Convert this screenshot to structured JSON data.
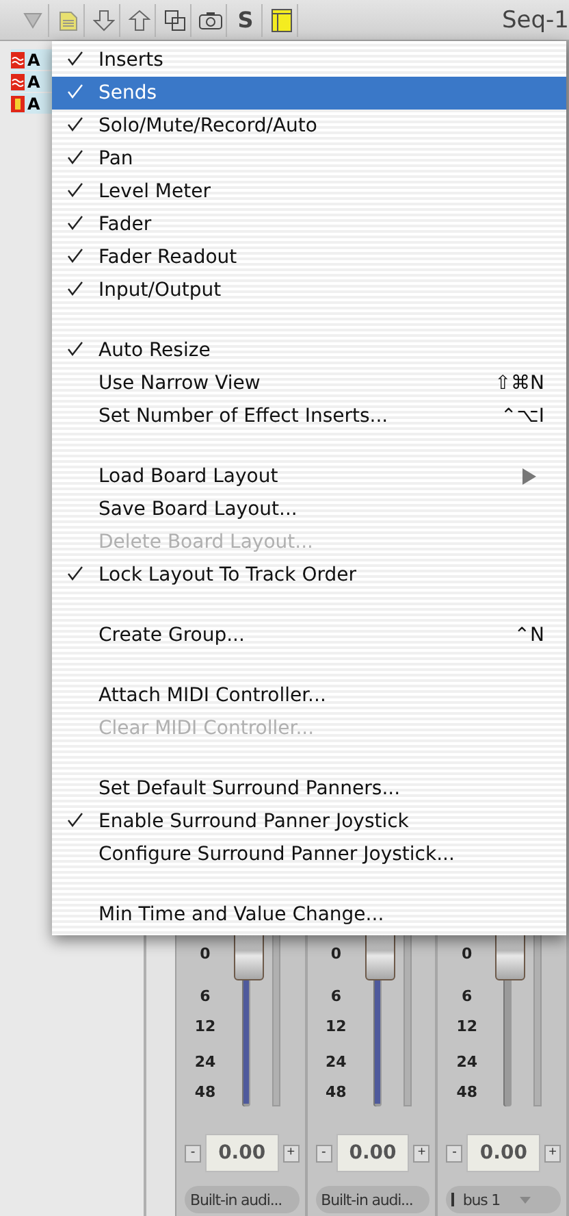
{
  "toolbar": {
    "buttons": [
      {
        "kind": "filter"
      },
      {
        "kind": "folder"
      },
      {
        "kind": "down"
      },
      {
        "kind": "up"
      },
      {
        "kind": "squares"
      },
      {
        "kind": "camera"
      },
      {
        "kind": "text",
        "label": "S"
      },
      {
        "kind": "window"
      }
    ],
    "title": "Seq-1"
  },
  "track_list": [
    {
      "label": "A",
      "kind": "audio"
    },
    {
      "label": "A",
      "kind": "audio"
    },
    {
      "label": "A",
      "kind": "instrument"
    }
  ],
  "menu": [
    {
      "kind": "item",
      "label": "Inserts",
      "checked": true,
      "selected": false,
      "disabled": false
    },
    {
      "kind": "item",
      "label": "Sends",
      "checked": true,
      "selected": true,
      "disabled": false
    },
    {
      "kind": "item",
      "label": "Solo/Mute/Record/Auto",
      "checked": true,
      "selected": false,
      "disabled": false
    },
    {
      "kind": "item",
      "label": "Pan",
      "checked": true,
      "selected": false,
      "disabled": false
    },
    {
      "kind": "item",
      "label": "Level Meter",
      "checked": true,
      "selected": false,
      "disabled": false
    },
    {
      "kind": "item",
      "label": "Fader",
      "checked": true,
      "selected": false,
      "disabled": false
    },
    {
      "kind": "item",
      "label": "Fader Readout",
      "checked": true,
      "selected": false,
      "disabled": false
    },
    {
      "kind": "item",
      "label": "Input/Output",
      "checked": true,
      "selected": false,
      "disabled": false
    },
    {
      "kind": "separator"
    },
    {
      "kind": "item",
      "label": "Auto Resize",
      "checked": true,
      "selected": false,
      "disabled": false
    },
    {
      "kind": "item",
      "label": "Use Narrow View",
      "checked": false,
      "selected": false,
      "disabled": false,
      "shortcut": "⇧⌘N"
    },
    {
      "kind": "item",
      "label": "Set Number of Effect Inserts...",
      "checked": false,
      "selected": false,
      "disabled": false,
      "shortcut": "⌃⌥I"
    },
    {
      "kind": "separator"
    },
    {
      "kind": "item",
      "label": "Load Board Layout",
      "checked": false,
      "selected": false,
      "disabled": false,
      "submenu": true
    },
    {
      "kind": "item",
      "label": "Save Board Layout...",
      "checked": false,
      "selected": false,
      "disabled": false
    },
    {
      "kind": "item",
      "label": "Delete Board Layout...",
      "checked": false,
      "selected": false,
      "disabled": true
    },
    {
      "kind": "item",
      "label": "Lock Layout To Track Order",
      "checked": true,
      "selected": false,
      "disabled": false
    },
    {
      "kind": "separator"
    },
    {
      "kind": "item",
      "label": "Create Group...",
      "checked": false,
      "selected": false,
      "disabled": false,
      "shortcut": "⌃N"
    },
    {
      "kind": "separator"
    },
    {
      "kind": "item",
      "label": "Attach MIDI Controller...",
      "checked": false,
      "selected": false,
      "disabled": false
    },
    {
      "kind": "item",
      "label": "Clear MIDI Controller...",
      "checked": false,
      "selected": false,
      "disabled": true
    },
    {
      "kind": "separator"
    },
    {
      "kind": "item",
      "label": "Set Default Surround Panners...",
      "checked": false,
      "selected": false,
      "disabled": false
    },
    {
      "kind": "item",
      "label": "Enable Surround Panner Joystick",
      "checked": true,
      "selected": false,
      "disabled": false
    },
    {
      "kind": "item",
      "label": "Configure Surround Panner Joystick...",
      "checked": false,
      "selected": false,
      "disabled": false
    },
    {
      "kind": "separator"
    },
    {
      "kind": "item",
      "label": "Min Time and Value Change...",
      "checked": false,
      "selected": false,
      "disabled": false
    }
  ],
  "strips": [
    {
      "scale": [
        "0",
        "6",
        "12",
        "24",
        "48"
      ],
      "fill_on": true,
      "minus": "-",
      "value": "0.00",
      "plus": "+",
      "output": "Built-in audi...",
      "bus": false
    },
    {
      "scale": [
        "0",
        "6",
        "12",
        "24",
        "48"
      ],
      "fill_on": true,
      "minus": "-",
      "value": "0.00",
      "plus": "+",
      "output": "Built-in audi...",
      "bus": false
    },
    {
      "scale": [
        "0",
        "6",
        "12",
        "24",
        "48"
      ],
      "fill_on": false,
      "minus": "-",
      "value": "0.00",
      "plus": "+",
      "output": "bus 1",
      "bus": true
    }
  ]
}
